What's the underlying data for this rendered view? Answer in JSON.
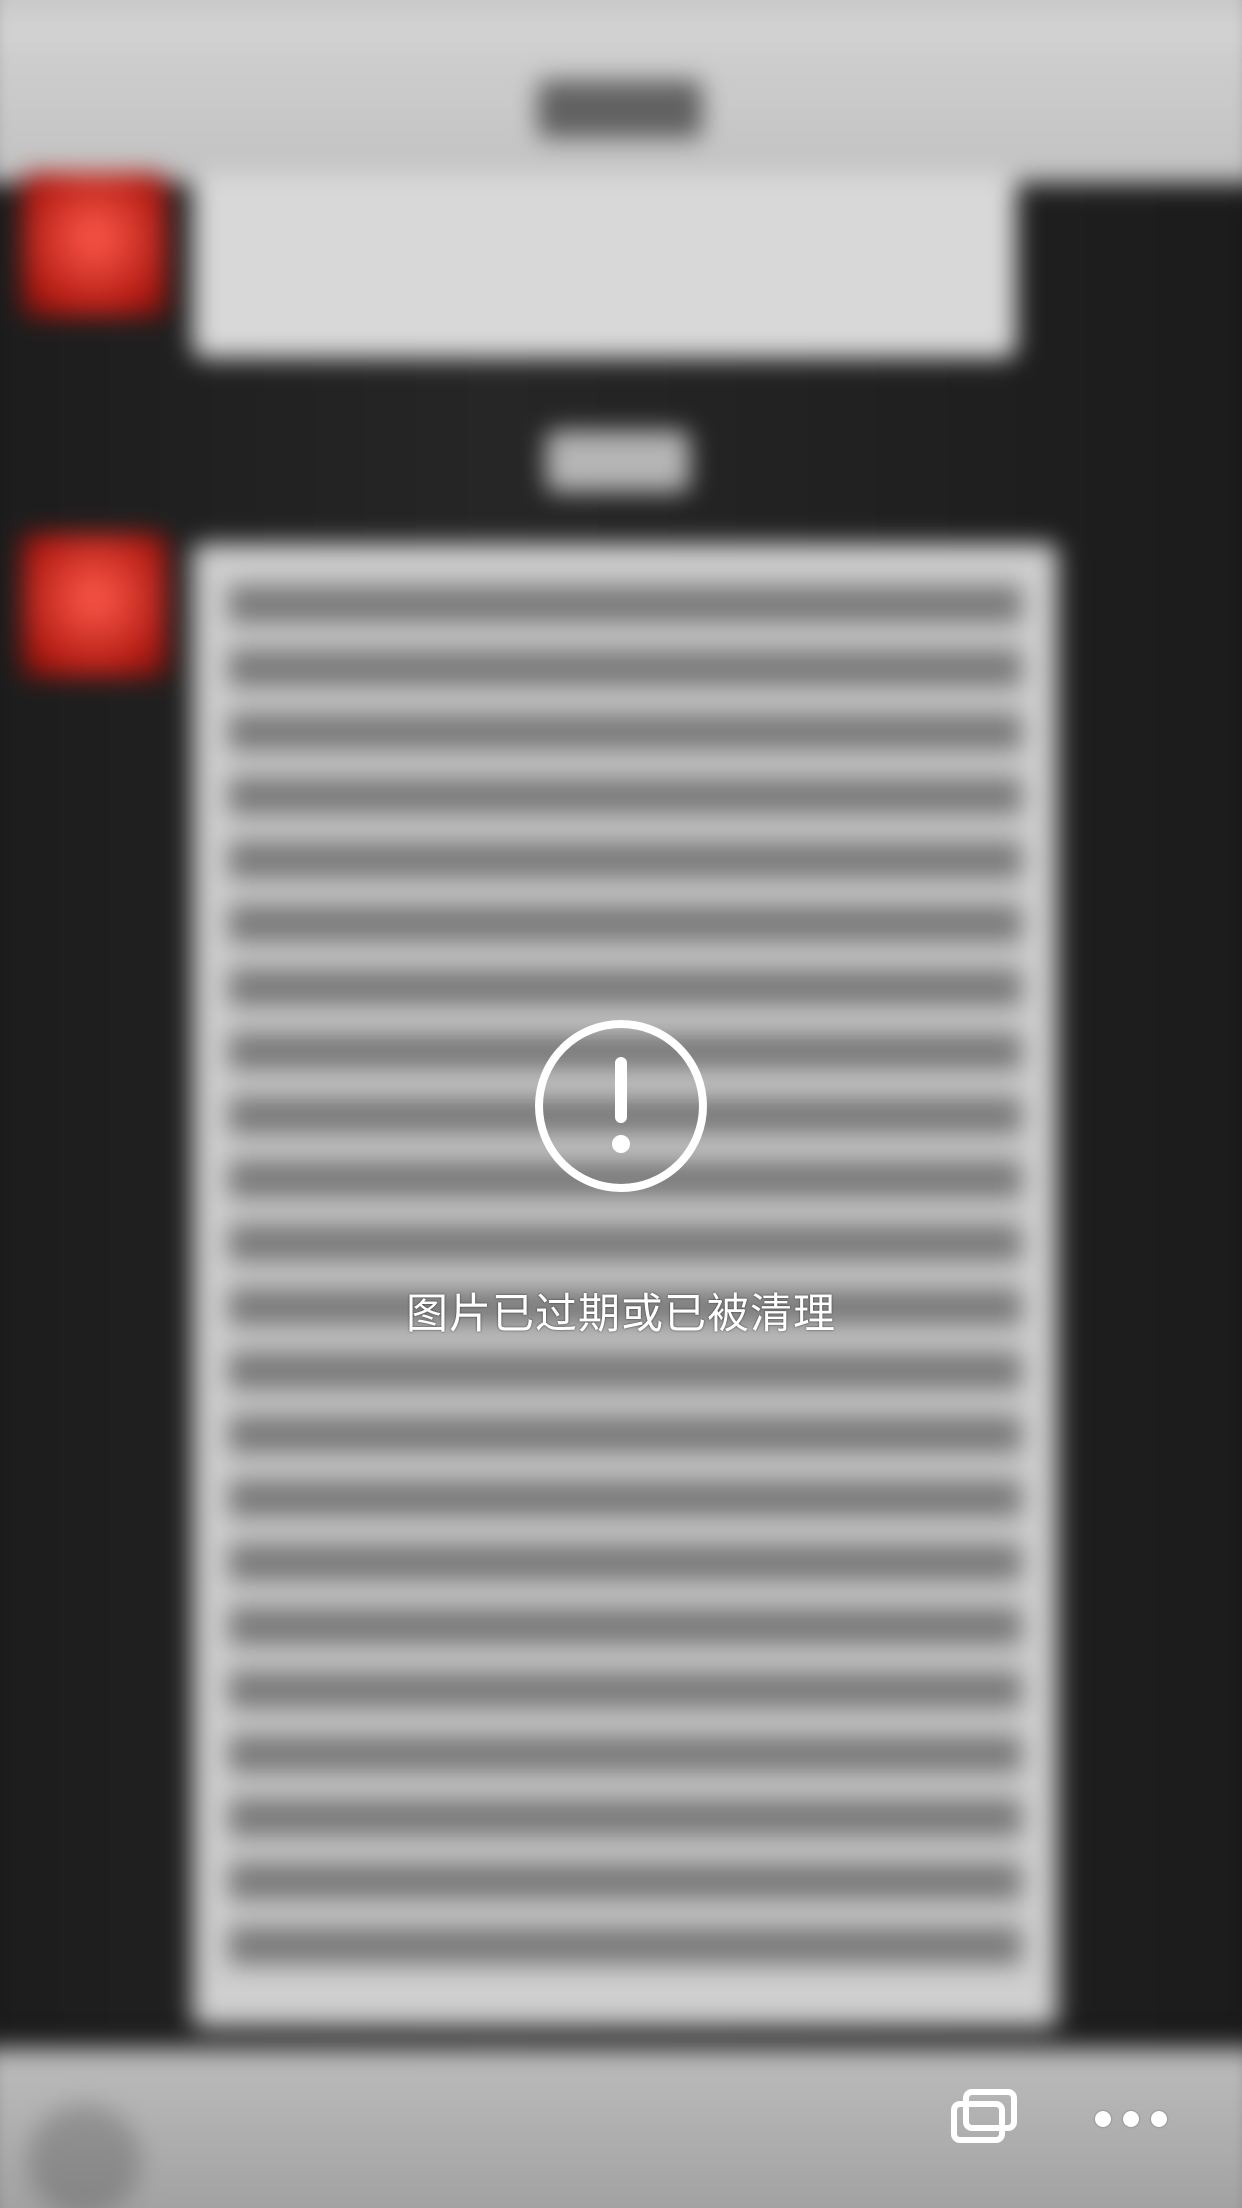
{
  "viewer": {
    "message": "图片已过期或已被清理"
  },
  "icons": {
    "warning": "exclamation-circle-icon",
    "multi_window": "multi-window-icon",
    "more": "more-horizontal-icon"
  },
  "colors": {
    "overlay_icon": "#FFFFFF",
    "overlay_text": "#FFFFFF",
    "avatar_red": "#D62B20",
    "bubble_gray": "#CFCFCF"
  }
}
